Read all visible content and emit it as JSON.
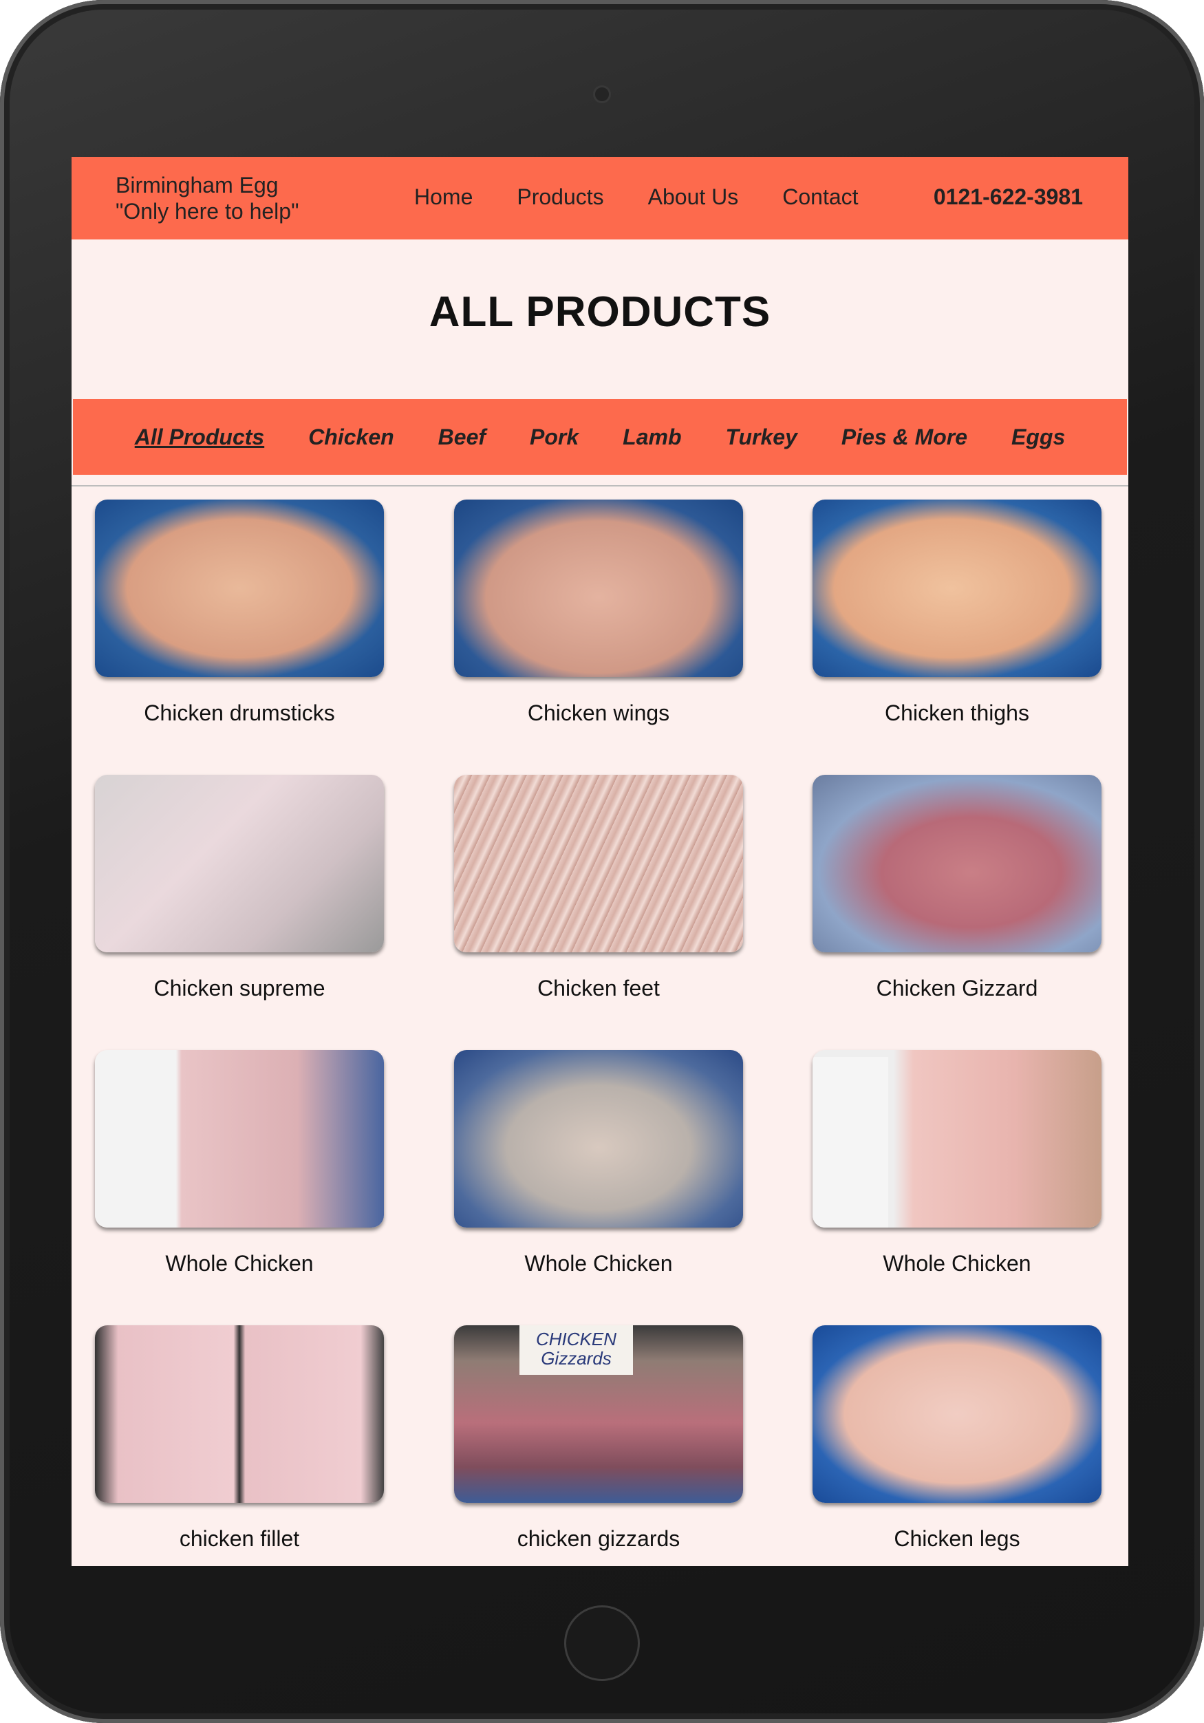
{
  "header": {
    "brand_line1": "Birmingham Egg",
    "brand_line2": "\"Only here to help\"",
    "nav": [
      "Home",
      "Products",
      "About Us",
      "Contact"
    ],
    "phone": "0121-622-3981"
  },
  "page": {
    "title": "ALL PRODUCTS"
  },
  "categories": {
    "items": [
      "All Products",
      "Chicken",
      "Beef",
      "Pork",
      "Lamb",
      "Turkey",
      "Pies & More",
      "Eggs"
    ],
    "active": "All Products"
  },
  "products": [
    {
      "name": "Chicken drumsticks"
    },
    {
      "name": "Chicken wings"
    },
    {
      "name": "Chicken thighs"
    },
    {
      "name": "Chicken supreme"
    },
    {
      "name": "Chicken feet"
    },
    {
      "name": "Chicken Gizzard"
    },
    {
      "name": "Whole Chicken"
    },
    {
      "name": "Whole Chicken"
    },
    {
      "name": "Whole Chicken"
    },
    {
      "name": "chicken fillet"
    },
    {
      "name": "chicken gizzards"
    },
    {
      "name": "Chicken legs"
    }
  ],
  "photo_labels": {
    "gizzards_sign": "CHICKEN Gizzards"
  }
}
